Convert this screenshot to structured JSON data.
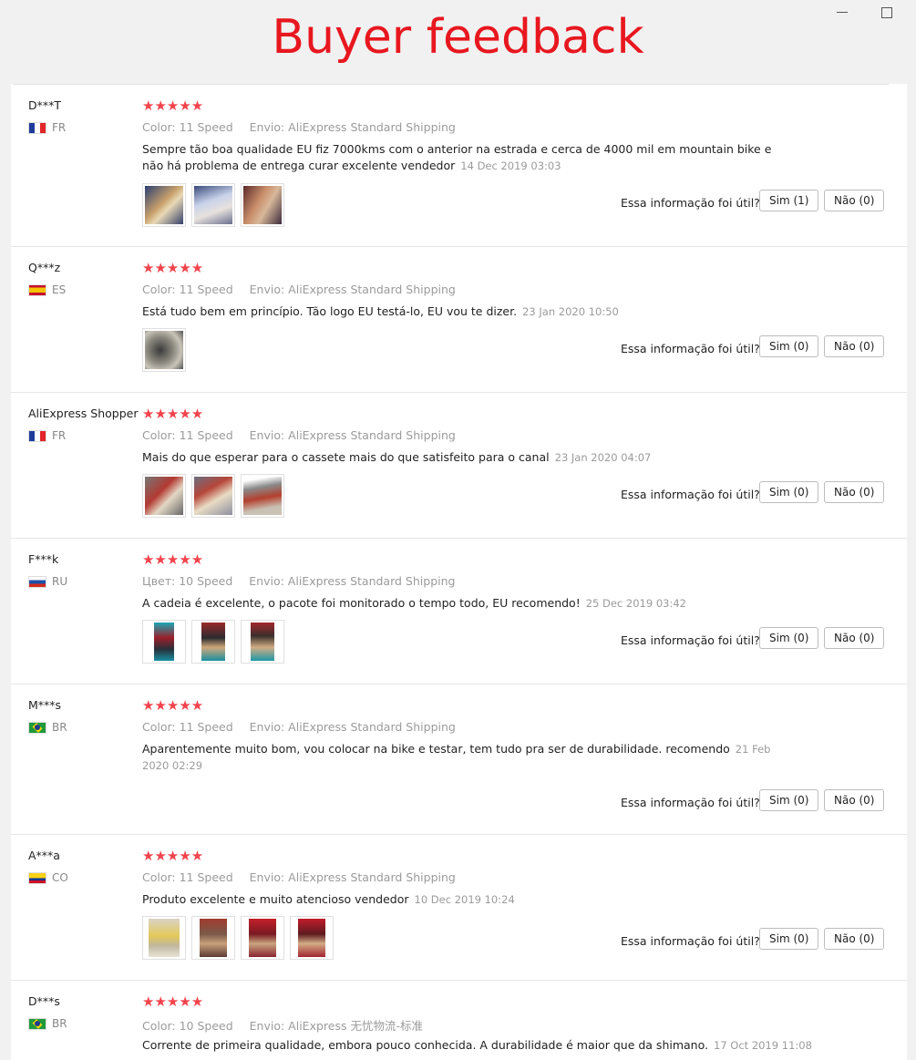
{
  "header": {
    "title": "Buyer feedback"
  },
  "helpful_label": "Essa informação foi útil?",
  "rating_glyphs": "★★★★★",
  "reviews": [
    {
      "user": "D***T",
      "country": "FR",
      "flag": "fr",
      "variant": "Color: 11 Speed",
      "shipping": "Envio: AliExpress Standard Shipping",
      "text": "Sempre tão boa qualidade EU fiz 7000kms com o anterior na estrada e cerca de 4000 mil em mountain bike e não há problema de entrega curar excelente vendedor",
      "date": "14 Dec 2019 03:03",
      "yes": "Sim (1)",
      "no": "Não (0)"
    },
    {
      "user": "Q***z",
      "country": "ES",
      "flag": "es",
      "variant": "Color: 11 Speed",
      "shipping": "Envio: AliExpress Standard Shipping",
      "text": "Está tudo bem em princípio. Tão logo EU testá-lo, EU vou te dizer.",
      "date": "23 Jan 2020 10:50",
      "yes": "Sim (0)",
      "no": "Não (0)"
    },
    {
      "user": "AliExpress Shopper",
      "country": "FR",
      "flag": "fr",
      "variant": "Color: 11 Speed",
      "shipping": "Envio: AliExpress Standard Shipping",
      "text": "Mais do que esperar para o cassete mais do que satisfeito para o canal",
      "date": "23 Jan 2020 04:07",
      "yes": "Sim (0)",
      "no": "Não (0)"
    },
    {
      "user": "F***k",
      "country": "RU",
      "flag": "ru",
      "variant": "Цвет: 10 Speed",
      "shipping": "Envio: AliExpress Standard Shipping",
      "text": "A cadeia é excelente, o pacote foi monitorado o tempo todo, EU recomendo!",
      "date": "25 Dec 2019 03:42",
      "yes": "Sim (0)",
      "no": "Não (0)"
    },
    {
      "user": "M***s",
      "country": "BR",
      "flag": "br",
      "variant": "Color: 11 Speed",
      "shipping": "Envio: AliExpress Standard Shipping",
      "text": "Aparentemente muito bom, vou colocar na bike e testar, tem tudo pra ser de durabilidade. recomendo",
      "date": "21 Feb 2020 02:29",
      "yes": "Sim (0)",
      "no": "Não (0)"
    },
    {
      "user": "A***a",
      "country": "CO",
      "flag": "co",
      "variant": "Color: 11 Speed",
      "shipping": "Envio: AliExpress Standard Shipping",
      "text": "Produto excelente e muito atencioso vendedor",
      "date": "10 Dec 2019 10:24",
      "yes": "Sim (0)",
      "no": "Não (0)"
    },
    {
      "user": "D***s",
      "country": "BR",
      "flag": "br",
      "variant": "Color: 10 Speed",
      "shipping": "Envio: AliExpress 无忧物流-标准",
      "text": "Corrente de primeira qualidade, embora pouco conhecida. A durabilidade é maior que da shimano.",
      "date": "17 Oct 2019 11:08",
      "yes": "",
      "no": ""
    }
  ]
}
